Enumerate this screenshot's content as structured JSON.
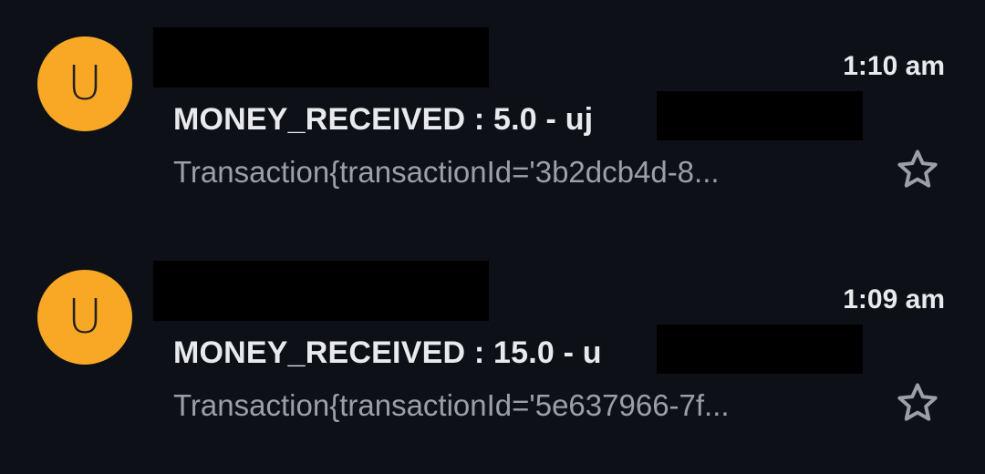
{
  "colors": {
    "background": "#0d1117",
    "avatar": "#f9a825",
    "primary_text": "#e8eaed",
    "secondary_text": "#9aa0a6",
    "redaction": "#000000"
  },
  "emails": [
    {
      "avatar_letter": "U",
      "time": "1:10 am",
      "subject": "MONEY_RECEIVED : 5.0 - uj",
      "snippet": "Transaction{transactionId='3b2dcb4d-8...",
      "star_icon": "star-outline-icon"
    },
    {
      "avatar_letter": "U",
      "time": "1:09 am",
      "subject": "MONEY_RECEIVED : 15.0 - u",
      "snippet": "Transaction{transactionId='5e637966-7f...",
      "star_icon": "star-outline-icon"
    }
  ]
}
